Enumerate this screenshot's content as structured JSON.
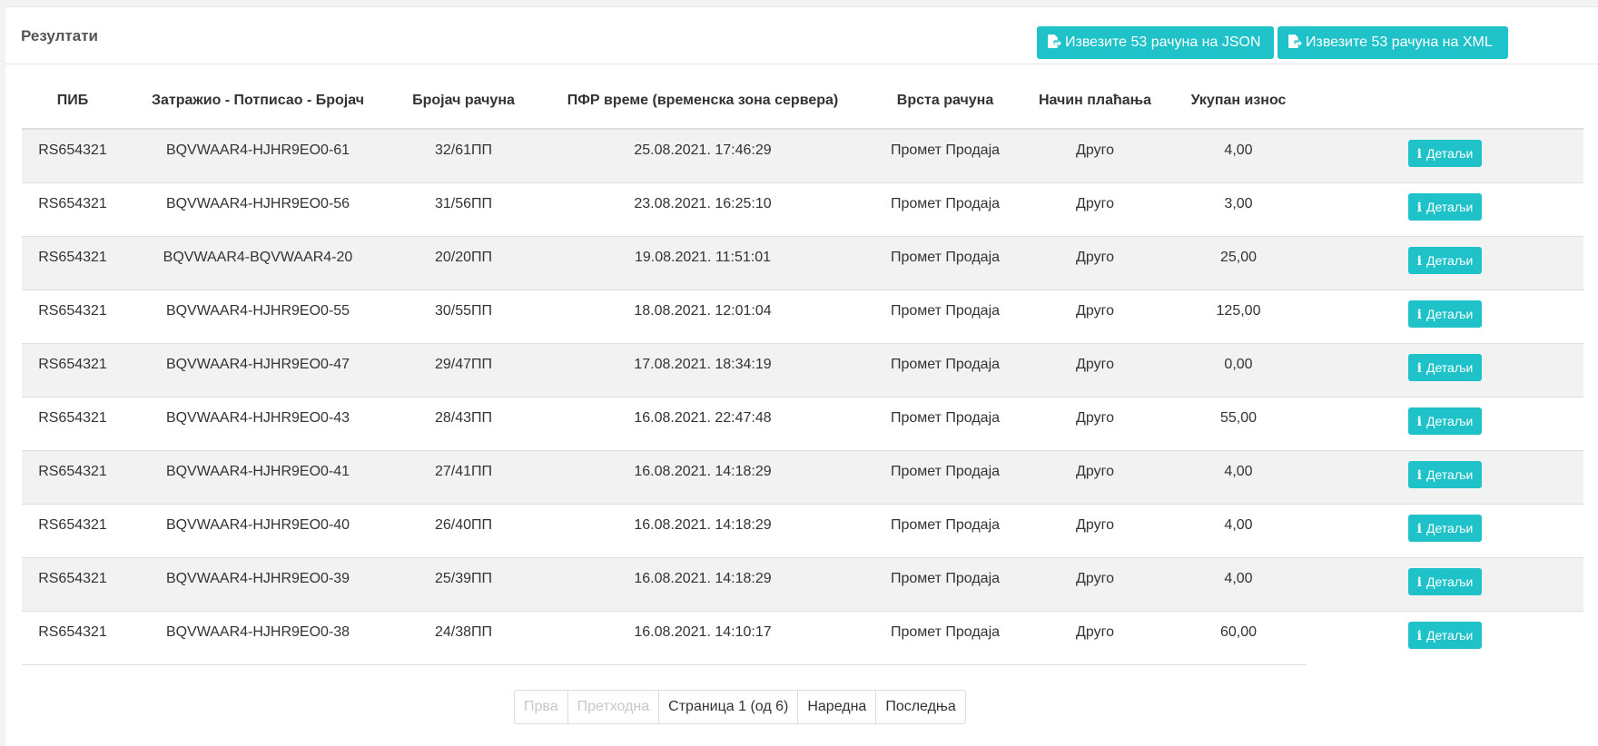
{
  "panel": {
    "title": "Резултати",
    "export_json_label": "Извезите 53 рачуна на JSON",
    "export_xml_label": "Извезите 53 рачуна на XML"
  },
  "table": {
    "headers": [
      "ПИБ",
      "Затражио - Потписао - Бројач",
      "Бројач рачуна",
      "ПФР време (временска зона сервера)",
      "Врста рачуна",
      "Начин плаћања",
      "Укупан износ"
    ],
    "details_label": "Детаљи",
    "rows": [
      {
        "pib": "RS654321",
        "requester": "BQVWAAR4-HJHR9EO0-61",
        "counter": "32/61ПП",
        "time": "25.08.2021. 17:46:29",
        "type": "Промет Продаја",
        "payment": "Друго",
        "total": "4,00"
      },
      {
        "pib": "RS654321",
        "requester": "BQVWAAR4-HJHR9EO0-56",
        "counter": "31/56ПП",
        "time": "23.08.2021. 16:25:10",
        "type": "Промет Продаја",
        "payment": "Друго",
        "total": "3,00"
      },
      {
        "pib": "RS654321",
        "requester": "BQVWAAR4-BQVWAAR4-20",
        "counter": "20/20ПП",
        "time": "19.08.2021. 11:51:01",
        "type": "Промет Продаја",
        "payment": "Друго",
        "total": "25,00"
      },
      {
        "pib": "RS654321",
        "requester": "BQVWAAR4-HJHR9EO0-55",
        "counter": "30/55ПП",
        "time": "18.08.2021. 12:01:04",
        "type": "Промет Продаја",
        "payment": "Друго",
        "total": "125,00"
      },
      {
        "pib": "RS654321",
        "requester": "BQVWAAR4-HJHR9EO0-47",
        "counter": "29/47ПП",
        "time": "17.08.2021. 18:34:19",
        "type": "Промет Продаја",
        "payment": "Друго",
        "total": "0,00"
      },
      {
        "pib": "RS654321",
        "requester": "BQVWAAR4-HJHR9EO0-43",
        "counter": "28/43ПП",
        "time": "16.08.2021. 22:47:48",
        "type": "Промет Продаја",
        "payment": "Друго",
        "total": "55,00"
      },
      {
        "pib": "RS654321",
        "requester": "BQVWAAR4-HJHR9EO0-41",
        "counter": "27/41ПП",
        "time": "16.08.2021. 14:18:29",
        "type": "Промет Продаја",
        "payment": "Друго",
        "total": "4,00"
      },
      {
        "pib": "RS654321",
        "requester": "BQVWAAR4-HJHR9EO0-40",
        "counter": "26/40ПП",
        "time": "16.08.2021. 14:18:29",
        "type": "Промет Продаја",
        "payment": "Друго",
        "total": "4,00"
      },
      {
        "pib": "RS654321",
        "requester": "BQVWAAR4-HJHR9EO0-39",
        "counter": "25/39ПП",
        "time": "16.08.2021. 14:18:29",
        "type": "Промет Продаја",
        "payment": "Друго",
        "total": "4,00"
      },
      {
        "pib": "RS654321",
        "requester": "BQVWAAR4-HJHR9EO0-38",
        "counter": "24/38ПП",
        "time": "16.08.2021. 14:10:17",
        "type": "Промет Продаја",
        "payment": "Друго",
        "total": "60,00"
      }
    ]
  },
  "pagination": {
    "first": "Прва",
    "previous": "Претходна",
    "current": "Страница 1 (од 6)",
    "next": "Наредна",
    "last": "Последња"
  },
  "colors": {
    "accent": "#1fc2c9",
    "stripe": "#f2f2f2"
  },
  "icons": {
    "export": "file-export-icon",
    "details": "info-icon"
  }
}
